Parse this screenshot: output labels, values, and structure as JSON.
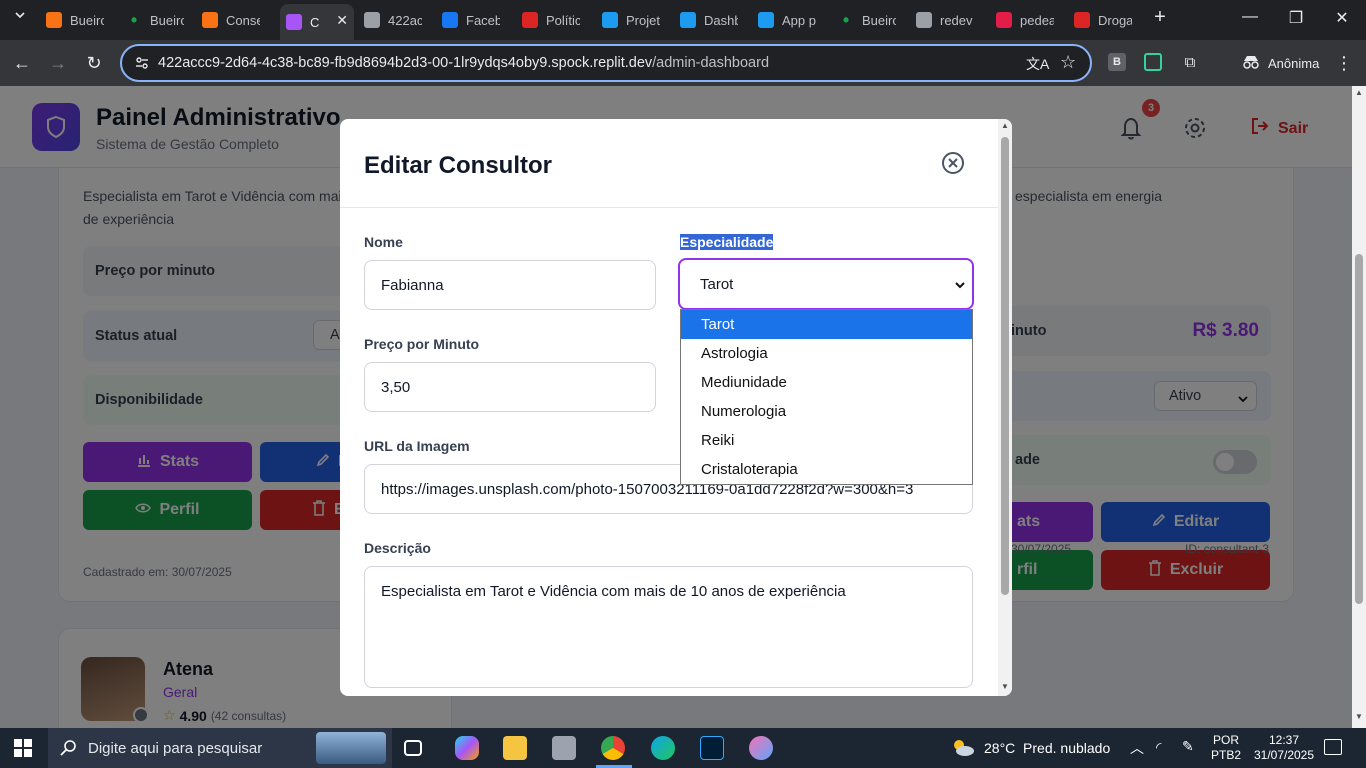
{
  "browser": {
    "tabs": [
      {
        "label": "Bueiro",
        "color": "#f97316",
        "icon": "dashboard-icon"
      },
      {
        "label": "Bueiro",
        "color": "#16a34a",
        "icon": "dot-icon"
      },
      {
        "label": "Conse",
        "color": "#f97316",
        "icon": "dashboard-icon"
      },
      {
        "label": "C",
        "color": "#a855f7",
        "icon": "star-icon"
      },
      {
        "label": "422ac",
        "color": "#9aa0a6",
        "icon": "globe-icon"
      },
      {
        "label": "Faceb",
        "color": "#1877f2",
        "icon": "facebook-icon"
      },
      {
        "label": "Polític",
        "color": "#dc2626",
        "icon": "policy-icon"
      },
      {
        "label": "Projet",
        "color": "#1d9bf0",
        "icon": "replit-icon"
      },
      {
        "label": "Dashb",
        "color": "#1d9bf0",
        "icon": "replit-icon"
      },
      {
        "label": "App p",
        "color": "#1d9bf0",
        "icon": "replit-icon"
      },
      {
        "label": "Bueiro",
        "color": "#16a34a",
        "icon": "dot-icon"
      },
      {
        "label": "redev",
        "color": "#9aa0a6",
        "icon": "globe-icon"
      },
      {
        "label": "pedea",
        "color": "#e11d48",
        "icon": "pinterest-icon"
      },
      {
        "label": "Droga",
        "color": "#dc2626",
        "icon": "droga-icon"
      }
    ],
    "url_host": "422accc9-2d64-4c38-bc89-fb9d8694b2d3-00-1lr9ydqs4oby9.spock.replit.dev",
    "url_path": "/admin-dashboard",
    "profile_label": "Anônima",
    "ext_b": "B"
  },
  "header": {
    "title": "Painel Administrativo",
    "subtitle": "Sistema de Gestão Completo",
    "notif_count": "3",
    "logout_label": "Sair"
  },
  "left_card": {
    "description": "Especialista em Tarot e Vidência com mais de 10 anos de experiência",
    "desc_line1": "Especialista em Tarot e Vidência com mais",
    "desc_line2": "de experiência",
    "price_label": "Preço por minuto",
    "status_label": "Status atual",
    "status_value": "At",
    "availability_label": "Disponibilidade",
    "stats_label": "Stats",
    "edit_label": "E",
    "profile_label": "Perfil",
    "delete_label": "Ex",
    "registered": "Cadastrado em: 30/07/2025"
  },
  "right_card": {
    "desc_fragment": "especialista em energia",
    "price_label": "inuto",
    "price_value": "R$ 3.80",
    "status_value": "Ativo",
    "availability_label": "ade",
    "stats_label": "ats",
    "edit_label": "Editar",
    "profile_label": "rfil",
    "delete_label": "Excluir",
    "date_fragment": "30/07/2025",
    "id_label": "ID: consultant-3"
  },
  "next_card": {
    "name": "Atena",
    "category": "Geral",
    "rating": "4.90",
    "consults": "(42 consultas)"
  },
  "modal": {
    "title": "Editar Consultor",
    "name_label": "Nome",
    "name_value": "Fabianna",
    "specialty_label": "Especialidade",
    "specialty_value": "Tarot",
    "price_label": "Preço por Minuto",
    "price_value": "3,50",
    "image_label": "URL da Imagem",
    "image_value": "https://images.unsplash.com/photo-1507003211169-0a1dd7228f2d?w=300&h=3",
    "desc_label": "Descrição",
    "desc_value": "Especialista em Tarot e Vidência com mais de 10 anos de experiência",
    "specialty_options": [
      "Tarot",
      "Astrologia",
      "Mediunidade",
      "Numerologia",
      "Reiki",
      "Cristaloterapia"
    ]
  },
  "taskbar": {
    "search_placeholder": "Digite aqui para pesquisar",
    "weather": "28°C  Pred. nublado",
    "lang1": "POR",
    "lang2": "PTB2",
    "time": "12:37",
    "date": "31/07/2025"
  },
  "colors": {
    "accent_purple": "#9333ea",
    "edit_blue": "#2563eb",
    "profile_green": "#16a34a",
    "delete_red": "#dc2626",
    "stats_purple": "#9333ea"
  }
}
